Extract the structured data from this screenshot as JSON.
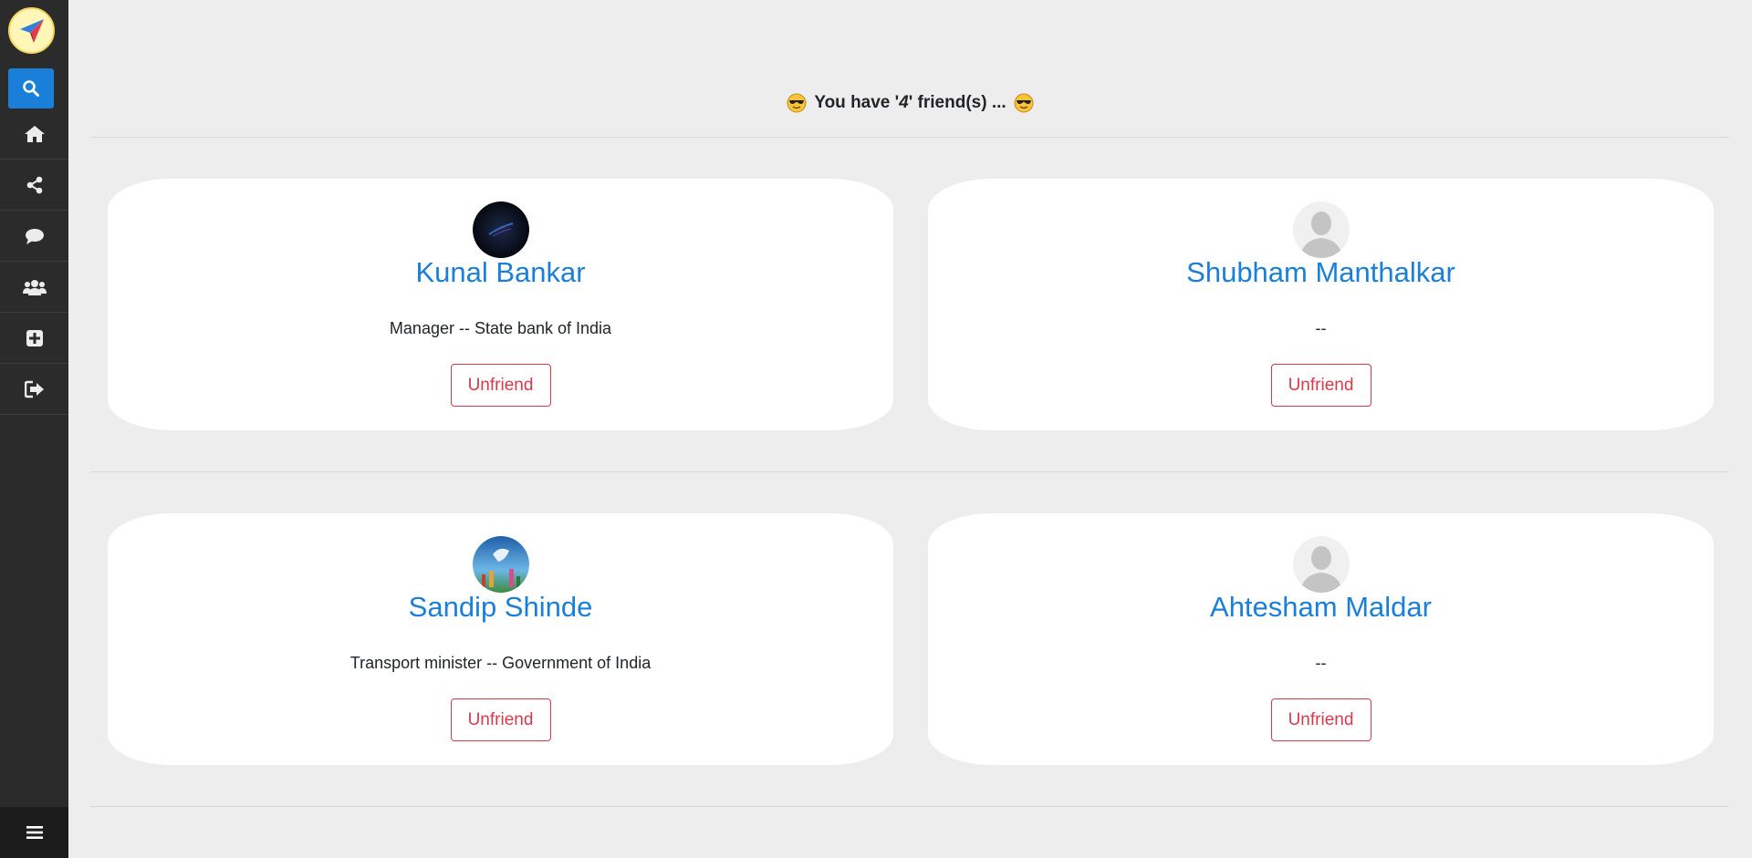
{
  "sidebar": {
    "logo_icon": "paper-plane-icon",
    "search_icon": "search-icon",
    "items": [
      {
        "name": "home",
        "icon": "home-icon"
      },
      {
        "name": "share",
        "icon": "share-icon"
      },
      {
        "name": "chat",
        "icon": "chat-icon"
      },
      {
        "name": "friends",
        "icon": "users-icon"
      },
      {
        "name": "add",
        "icon": "plus-square-icon"
      },
      {
        "name": "logout",
        "icon": "sign-out-icon"
      }
    ],
    "menu_icon": "hamburger-menu-icon"
  },
  "colors": {
    "sidebar_bg": "#2b2b2b",
    "accent": "#1a7fd8",
    "danger": "#d83a4a",
    "page_bg": "#ededed"
  },
  "heading": {
    "prefix": "You have '",
    "count": "4",
    "suffix": "' friend(s) ..."
  },
  "friends": [
    {
      "name": "Kunal Bankar",
      "occupation": "Manager -- State bank of India",
      "action": "Unfriend",
      "avatar": "dark-abstract-photo"
    },
    {
      "name": "Shubham Manthalkar",
      "occupation": "--",
      "action": "Unfriend",
      "avatar": "default-user-silhouette"
    },
    {
      "name": "Sandip Shinde",
      "occupation": "Transport minister -- Government of India",
      "action": "Unfriend",
      "avatar": "colorful-landscape-photo"
    },
    {
      "name": "Ahtesham Maldar",
      "occupation": "--",
      "action": "Unfriend",
      "avatar": "default-user-silhouette"
    }
  ]
}
